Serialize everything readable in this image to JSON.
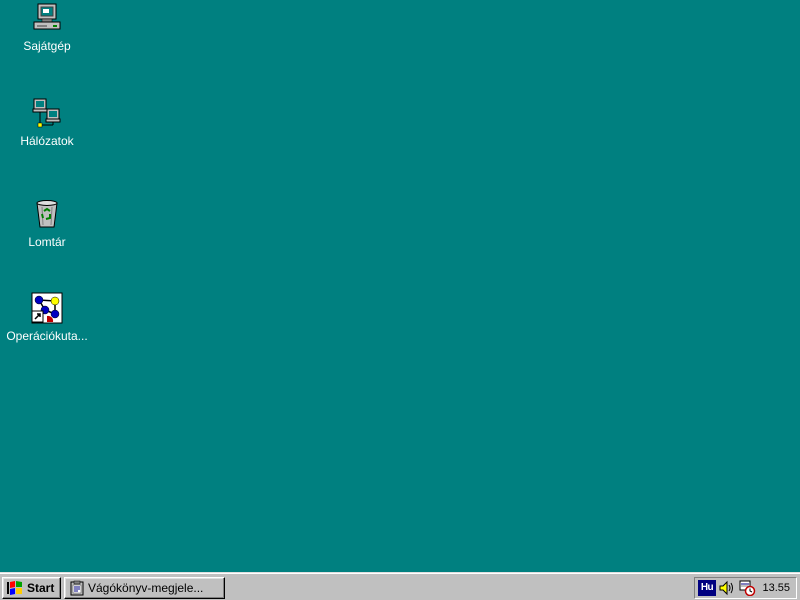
{
  "desktop": {
    "background_color": "#008080",
    "icons": [
      {
        "label": "Sajátgép",
        "icon": "my-computer-icon"
      },
      {
        "label": "Hálózatok",
        "icon": "network-neighborhood-icon"
      },
      {
        "label": "Lomtár",
        "icon": "recycle-bin-icon"
      },
      {
        "label": "Operációkuta...",
        "icon": "application-shortcut-icon"
      }
    ]
  },
  "taskbar": {
    "start_label": "Start",
    "task_label": "Vágókönyv-megjele...",
    "tray": {
      "language": "Hu",
      "volume_icon": "speaker-icon",
      "scheduler_icon": "task-scheduler-icon",
      "clock": "13.55"
    }
  }
}
